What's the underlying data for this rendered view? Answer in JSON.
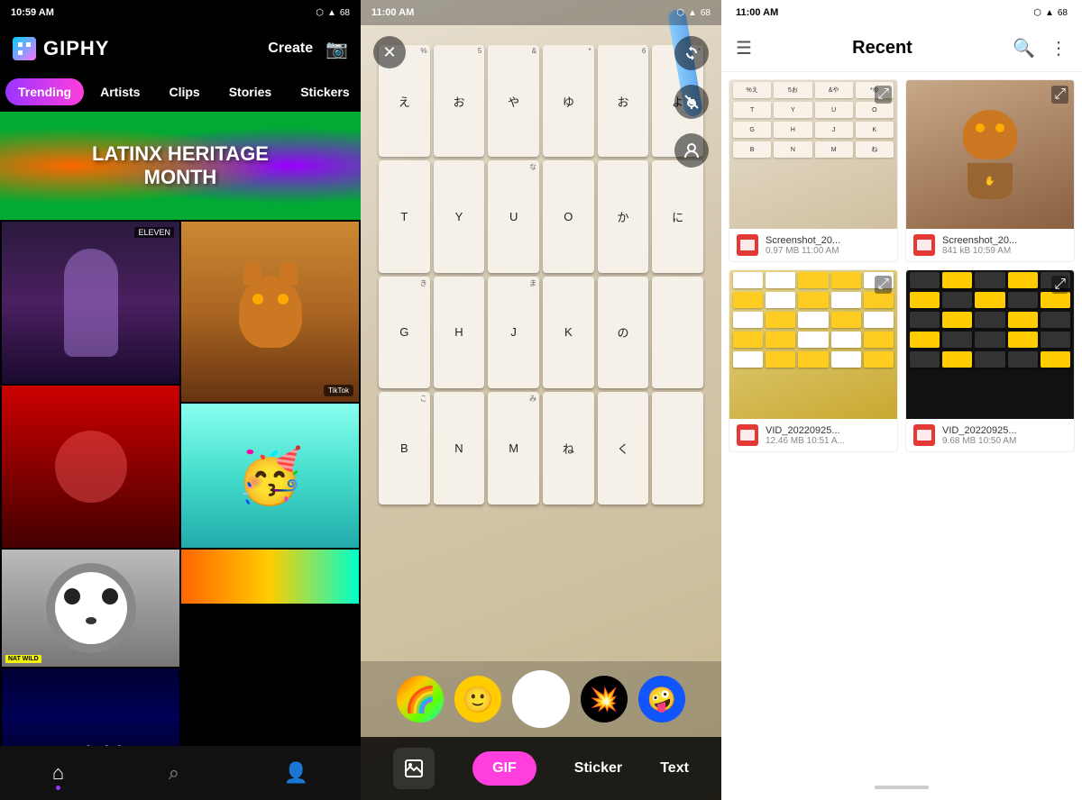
{
  "panel1": {
    "status_bar": {
      "time": "10:59 AM",
      "icons": "📶 🔋"
    },
    "header": {
      "logo_text": "GIPHY",
      "create_label": "Create",
      "camera_icon": "📷"
    },
    "nav": {
      "tabs": [
        {
          "label": "Trending",
          "active": true
        },
        {
          "label": "Artists",
          "active": false
        },
        {
          "label": "Clips",
          "active": false
        },
        {
          "label": "Stories",
          "active": false
        },
        {
          "label": "Stickers",
          "active": false
        }
      ]
    },
    "banner": {
      "text": "LATINX HERITAGE\nMONTH"
    },
    "bottom_nav": {
      "items": [
        {
          "icon": "🏠",
          "label": "home",
          "active": true
        },
        {
          "icon": "🔍",
          "label": "search",
          "active": false
        },
        {
          "icon": "👤",
          "label": "profile",
          "active": false
        }
      ]
    }
  },
  "panel2": {
    "status_bar": {
      "time": "11:00 AM"
    },
    "controls": {
      "close_icon": "✕",
      "flip_icon": "🔄",
      "mute_icon": "🔇",
      "portrait_icon": "👤"
    },
    "stickers": [
      {
        "type": "rainbow",
        "emoji": "🌈"
      },
      {
        "type": "smiley",
        "emoji": "😊"
      },
      {
        "type": "burst",
        "emoji": "💥"
      },
      {
        "type": "crazy",
        "emoji": "🤪"
      }
    ],
    "modes": {
      "gallery_label": "🖼",
      "gif_label": "GIF",
      "sticker_label": "Sticker",
      "text_label": "Text"
    }
  },
  "panel3": {
    "status_bar": {
      "time": "11:00 AM"
    },
    "header": {
      "title": "Recent",
      "search_icon": "🔍",
      "more_icon": "⋮"
    },
    "files": [
      {
        "id": "file1",
        "name": "Screenshot_20...",
        "size": "0.97 MB",
        "time": "11:00 AM",
        "type": "screenshot",
        "thumb_type": "keyboard1"
      },
      {
        "id": "file2",
        "name": "Screenshot_20...",
        "size": "841 kB",
        "time": "10:59 AM",
        "type": "screenshot",
        "thumb_type": "screenshot_cat"
      },
      {
        "id": "file3",
        "name": "VID_20220925...",
        "size": "12.46 MB",
        "time": "10:51 A...",
        "type": "video",
        "thumb_type": "yellow_keys"
      },
      {
        "id": "file4",
        "name": "VID_20220925...",
        "size": "9.68 MB",
        "time": "10:50 AM",
        "type": "video",
        "thumb_type": "dark_keys"
      }
    ]
  }
}
